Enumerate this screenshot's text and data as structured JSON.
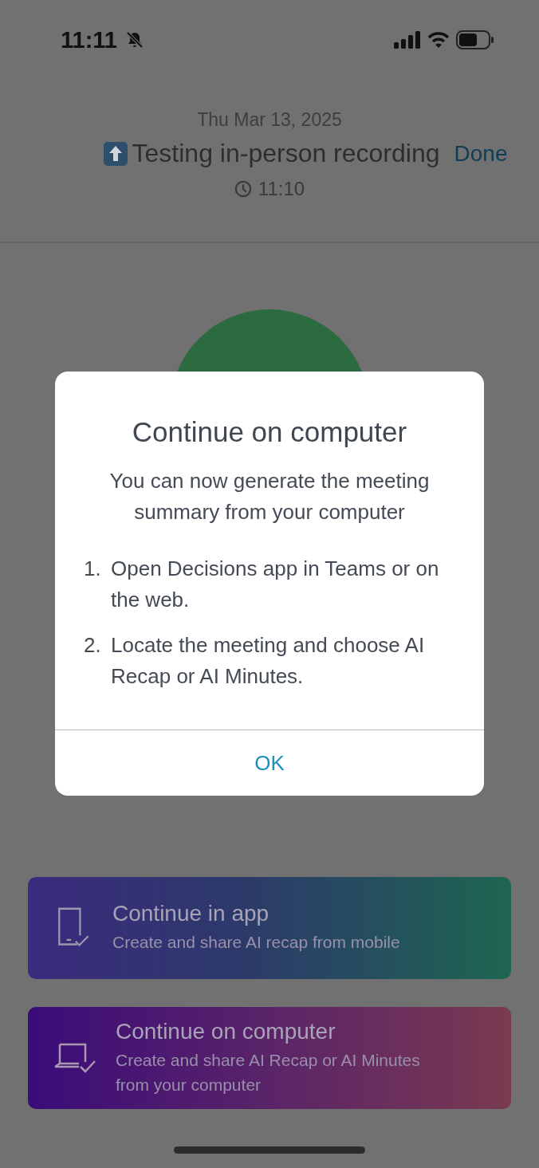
{
  "status_bar": {
    "time": "11:11"
  },
  "header": {
    "date": "Thu Mar 13, 2025",
    "title": "Testing in-person recording",
    "done": "Done",
    "time": "11:10"
  },
  "dialog": {
    "title": "Continue on computer",
    "message": "You can now generate the meeting summary from your computer",
    "steps": [
      {
        "number": "1.",
        "text": "Open Decisions app in Teams or on the web."
      },
      {
        "number": "2.",
        "text": "Locate the meeting and choose AI Recap or AI Minutes."
      }
    ],
    "button": "OK"
  },
  "options": [
    {
      "kind": "app",
      "title": "Continue in app",
      "subtitle": "Create and share AI recap from mobile"
    },
    {
      "kind": "computer",
      "title": "Continue on computer",
      "subtitle": "Create and share AI Recap or AI Minutes from your computer"
    }
  ]
}
